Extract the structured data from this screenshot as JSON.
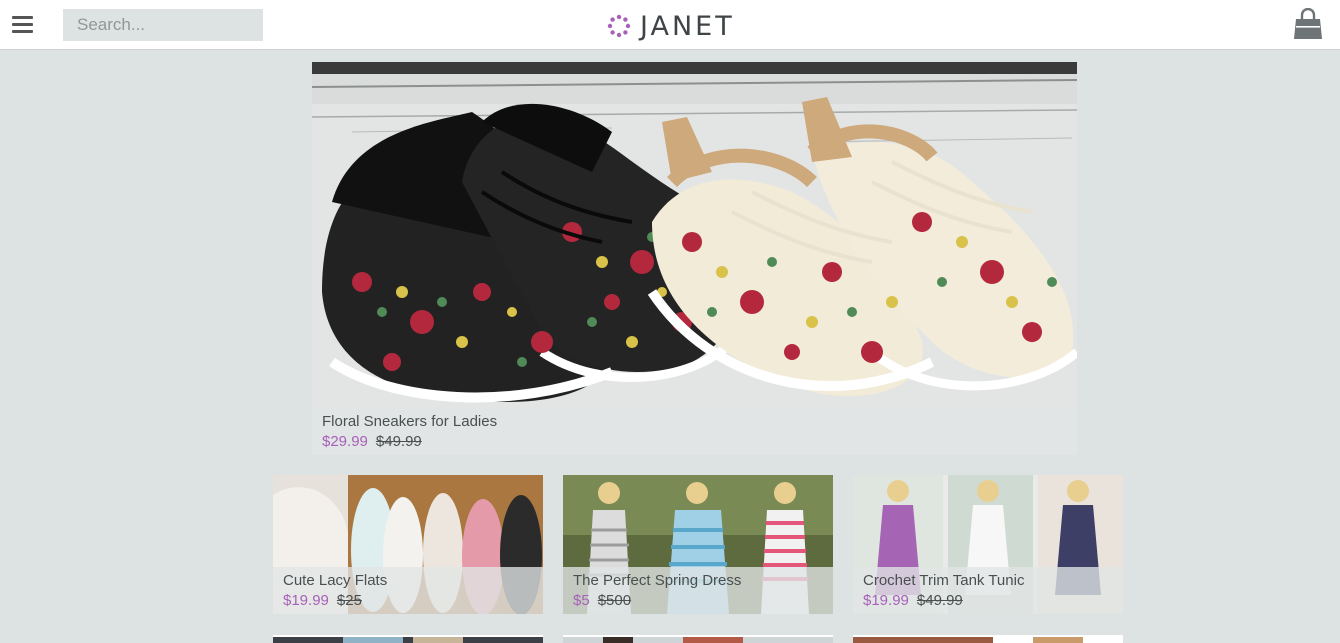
{
  "header": {
    "search_placeholder": "Search...",
    "logo_text": "JANET",
    "menu_icon": "hamburger-menu-icon",
    "bag_icon": "shopping-bag-icon",
    "accent": "#a761b8"
  },
  "hero": {
    "title": "Floral Sneakers for Ladies",
    "price": "$29.99",
    "old_price": "$49.99"
  },
  "products": [
    {
      "title": "Cute Lacy Flats",
      "price": "$19.99",
      "old_price": "$25"
    },
    {
      "title": "The Perfect Spring Dress",
      "price": "$5",
      "old_price": "$500"
    },
    {
      "title": "Crochet Trim Tank Tunic",
      "price": "$19.99",
      "old_price": "$49.99"
    }
  ]
}
